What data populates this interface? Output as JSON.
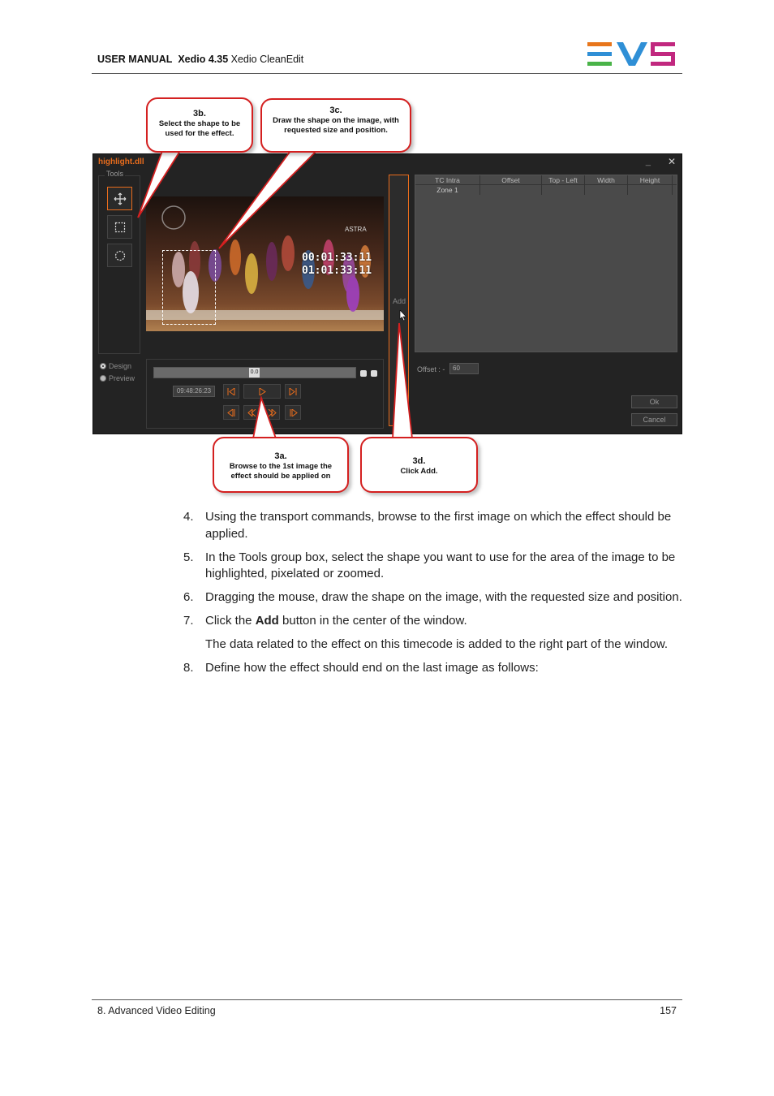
{
  "header": {
    "manual": "USER MANUAL",
    "product": "Xedio 4.35",
    "module": "Xedio CleanEdit",
    "brand_colors": {
      "orange": "#e8761c",
      "blue": "#2f8fd6",
      "green": "#49b348",
      "magenta": "#c1287f"
    }
  },
  "footer": {
    "chapter": "8. Advanced Video Editing",
    "page": "157"
  },
  "window": {
    "title": "highlight.dll",
    "minimize": "_",
    "close": "✕",
    "tools_label": "Tools",
    "tools": [
      {
        "name": "move-tool",
        "icon": "move-arrows-icon",
        "selected": true
      },
      {
        "name": "rectangle-tool",
        "icon": "rectangle-select-icon",
        "selected": false
      },
      {
        "name": "ellipse-tool",
        "icon": "ellipse-select-icon",
        "selected": false
      }
    ],
    "modes": [
      {
        "label": "Design",
        "selected": true
      },
      {
        "label": "Preview",
        "selected": false
      }
    ],
    "video_overlay": {
      "tc_line1": "00:01:33:11",
      "tc_line2": "01:01:33:11",
      "brand": "ASTRA"
    },
    "timeline_handle": "0.0",
    "timecode": "09:48:26:23",
    "add_label": "Add",
    "table": {
      "columns": [
        "TC Intra",
        "Offset",
        "Top - Left",
        "Width",
        "Height"
      ],
      "rows": [
        [
          "Zone 1",
          "",
          "",
          "",
          ""
        ]
      ]
    },
    "offset_label": "Offset :",
    "offset_sign": "-",
    "offset_value": "60",
    "ok_label": "Ok",
    "cancel_label": "Cancel",
    "accent_color": "#e86c1c"
  },
  "callouts": {
    "c3b": {
      "num": "3b.",
      "text": "Select the shape to be used for the effect."
    },
    "c3c": {
      "num": "3c.",
      "text": "Draw the shape on the image, with requested size and position."
    },
    "c3a": {
      "num": "3a.",
      "text": "Browse to the 1st image the effect should be applied on"
    },
    "c3d": {
      "num": "3d.",
      "text": "Click Add."
    }
  },
  "steps": {
    "s4": {
      "num": "4.",
      "text": "Using the transport commands, browse to the first image on which the effect should be applied."
    },
    "s5": {
      "num": "5.",
      "text": "In the Tools group box, select the shape you want to use for the area of the image to be highlighted, pixelated or zoomed."
    },
    "s6": {
      "num": "6.",
      "text": "Dragging the mouse, draw the shape on the image, with the requested size and position."
    },
    "s7": {
      "num": "7.",
      "pre": "Click the ",
      "bold": "Add",
      "post": " button in the center of the window."
    },
    "s7_note": "The data related to the effect on this timecode is added to the right part of the window.",
    "s8": {
      "num": "8.",
      "text": "Define how the effect should end on the last image as follows:"
    }
  }
}
